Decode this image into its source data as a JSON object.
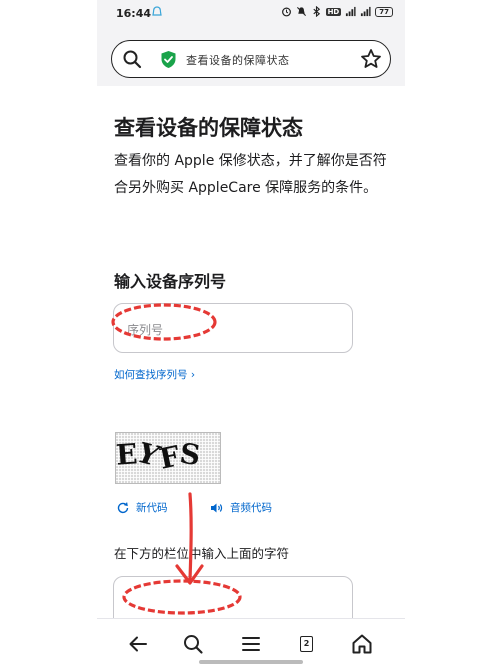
{
  "status_bar": {
    "time": "16:44",
    "volte": "HD",
    "battery": "77"
  },
  "browser": {
    "url_title": "查看设备的保障状态",
    "secure_color": "#1aa34a"
  },
  "page": {
    "title": "查看设备的保障状态",
    "description": "查看你的 Apple 保修状态，并了解你是否符合另外购买 AppleCare 保障服务的条件。",
    "serial_section_label": "输入设备序列号",
    "serial_placeholder": "序列号",
    "find_serial_link": "如何查找序列号 ›",
    "captcha_image_text": "EYFS",
    "new_code_label": "新代码",
    "audio_code_label": "音频代码",
    "enter_chars_label": "在下方的栏位中输入上面的字符"
  },
  "nav": {
    "tab_count": "2"
  },
  "colors": {
    "link": "#0066cc",
    "annotation": "#e53935"
  }
}
